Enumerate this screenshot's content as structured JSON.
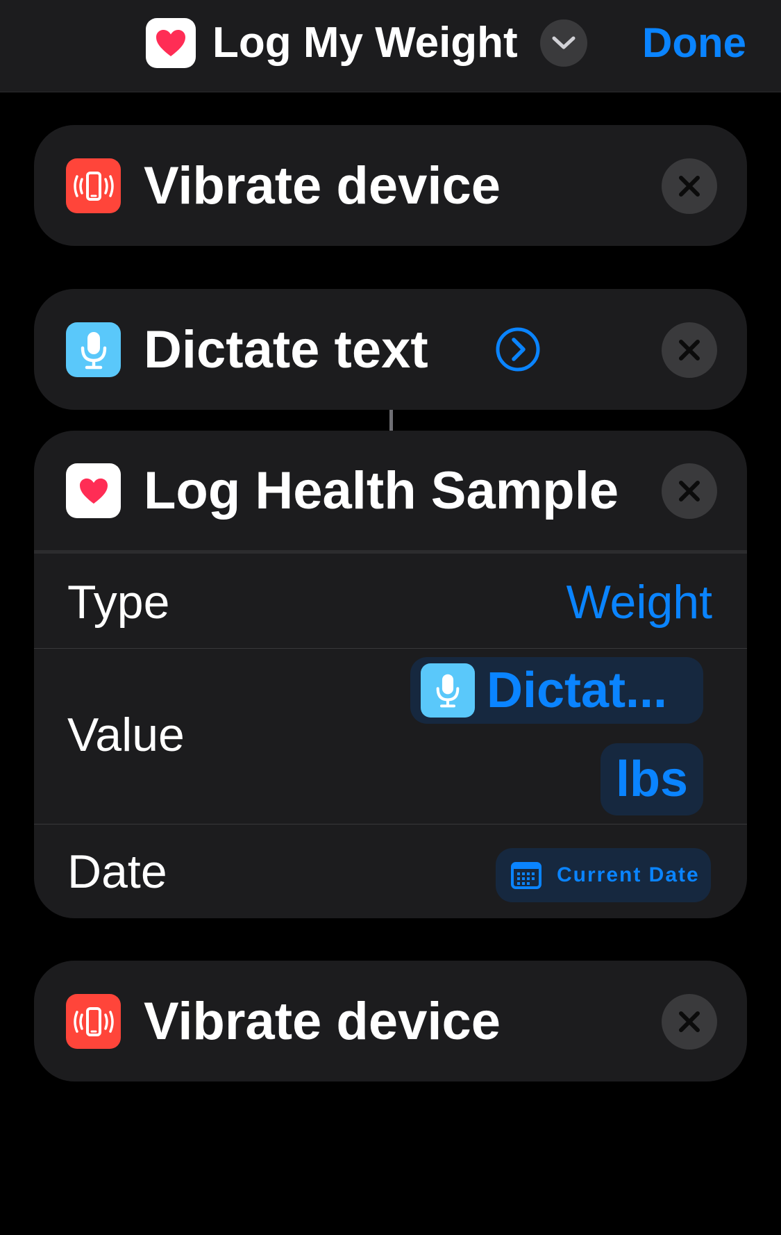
{
  "header": {
    "title": "Log My Weight",
    "done_label": "Done",
    "app_icon": "heart-icon",
    "menu_icon": "chevron-down-icon"
  },
  "actions": [
    {
      "label": "Vibrate device",
      "icon": "vibrate-phone-icon",
      "icon_color": "#ff453a"
    },
    {
      "label": "Dictate text",
      "icon": "microphone-icon",
      "icon_color": "#5ac8fa"
    },
    {
      "label": "Log Health Sample",
      "icon": "heart-icon",
      "params": {
        "type_label": "Type",
        "type_value": "Weight",
        "value_label": "Value",
        "value_token": "Dictat...",
        "value_unit": "lbs",
        "date_label": "Date",
        "date_token": "Current Date"
      }
    },
    {
      "label": "Vibrate device",
      "icon": "vibrate-phone-icon",
      "icon_color": "#ff453a"
    }
  ],
  "colors": {
    "accent": "#0a84ff",
    "background": "#000000",
    "card": "#1c1c1e",
    "health_heart": "#ff2d55"
  }
}
